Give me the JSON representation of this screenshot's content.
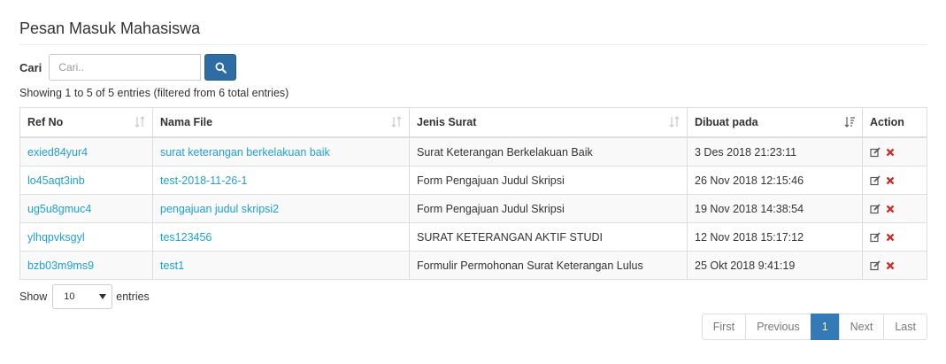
{
  "page": {
    "title": "Pesan Masuk Mahasiswa"
  },
  "search": {
    "label": "Cari",
    "placeholder": "Cari.."
  },
  "info_text": "Showing 1 to 5 of 5 entries (filtered from 6 total entries)",
  "table": {
    "headers": [
      "Ref No",
      "Nama File",
      "Jenis Surat",
      "Dibuat pada",
      "Action"
    ],
    "rows": [
      {
        "ref": "exied84yur4",
        "file": "surat keterangan berkelakuan baik",
        "jenis": "Surat Keterangan Berkelakuan Baik",
        "date": "3 Des 2018 21:23:11"
      },
      {
        "ref": "lo45aqt3inb",
        "file": "test-2018-11-26-1",
        "jenis": "Form Pengajuan Judul Skripsi",
        "date": "26 Nov 2018 12:15:46"
      },
      {
        "ref": "ug5u8gmuc4",
        "file": "pengajuan judul skripsi2",
        "jenis": "Form Pengajuan Judul Skripsi",
        "date": "19 Nov 2018 14:38:54"
      },
      {
        "ref": "ylhqpvksgyl",
        "file": "tes123456",
        "jenis": "SURAT KETERANGAN AKTIF STUDI",
        "date": "12 Nov 2018 15:17:12"
      },
      {
        "ref": "bzb03m9ms9",
        "file": "test1",
        "jenis": "Formulir Permohonan Surat Keterangan Lulus",
        "date": "25 Okt 2018 9:41:19"
      }
    ]
  },
  "length": {
    "show": "Show",
    "value": "10",
    "entries": "entries"
  },
  "pagination": {
    "first": "First",
    "previous": "Previous",
    "current": "1",
    "next": "Next",
    "last": "Last"
  },
  "colors": {
    "link": "#1fa0d6",
    "primary": "#337ab7",
    "delete": "#c9302c"
  }
}
